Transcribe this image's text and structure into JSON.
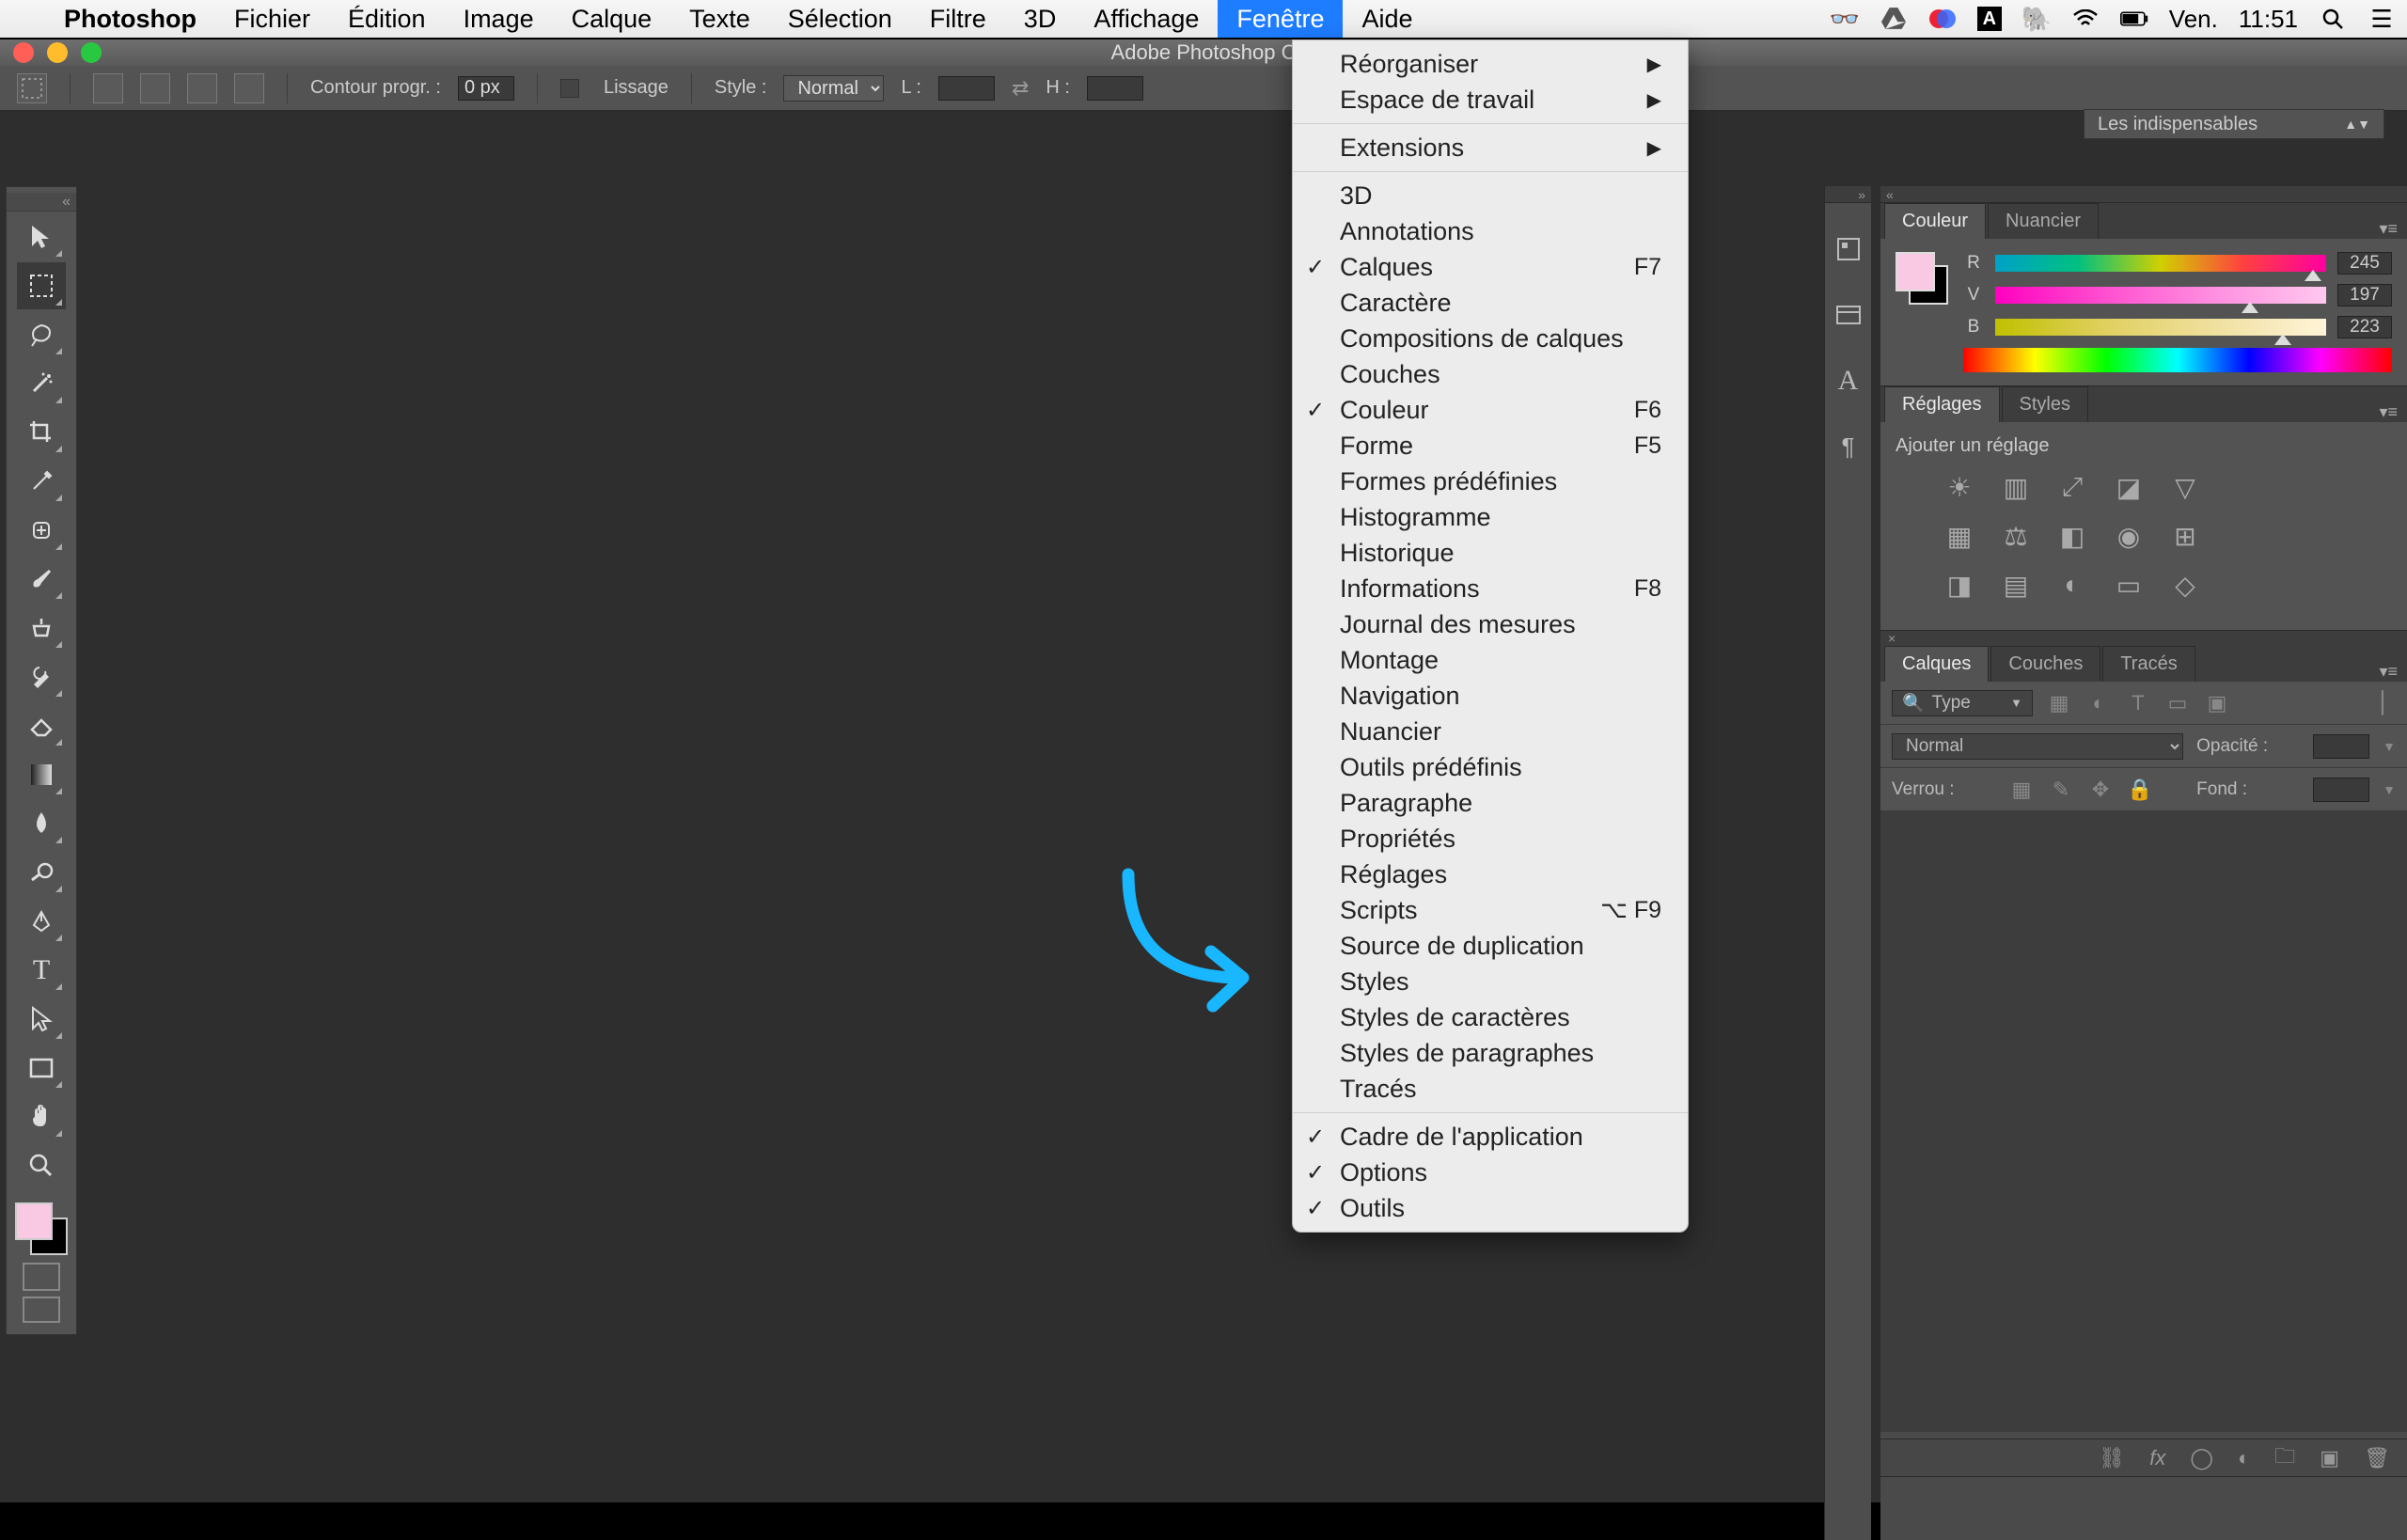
{
  "menubar": {
    "app": "Photoshop",
    "items": [
      "Fichier",
      "Édition",
      "Image",
      "Calque",
      "Texte",
      "Sélection",
      "Filtre",
      "3D",
      "Affichage",
      "Fenêtre",
      "Aide"
    ],
    "activeIndex": 9,
    "right": {
      "day": "Ven.",
      "time": "11:51"
    }
  },
  "window_title": "Adobe Photoshop C",
  "options_bar": {
    "feather_label": "Contour progr. :",
    "feather_value": "0 px",
    "antialias_label": "Lissage",
    "style_label": "Style :",
    "style_value": "Normal",
    "width_label": "L :",
    "height_label": "H :"
  },
  "workspace_selector": "Les indispensables",
  "dropdown": {
    "groups": [
      [
        {
          "label": "Réorganiser",
          "arrow": true
        },
        {
          "label": "Espace de travail",
          "arrow": true
        }
      ],
      [
        {
          "label": "Extensions",
          "arrow": true
        }
      ],
      [
        {
          "label": "3D"
        },
        {
          "label": "Annotations"
        },
        {
          "label": "Calques",
          "checked": true,
          "shortcut": "F7"
        },
        {
          "label": "Caractère"
        },
        {
          "label": "Compositions de calques"
        },
        {
          "label": "Couches"
        },
        {
          "label": "Couleur",
          "checked": true,
          "shortcut": "F6"
        },
        {
          "label": "Forme",
          "shortcut": "F5"
        },
        {
          "label": "Formes prédéfinies"
        },
        {
          "label": "Histogramme"
        },
        {
          "label": "Historique"
        },
        {
          "label": "Informations",
          "shortcut": "F8"
        },
        {
          "label": "Journal des mesures"
        },
        {
          "label": "Montage"
        },
        {
          "label": "Navigation"
        },
        {
          "label": "Nuancier"
        },
        {
          "label": "Outils prédéfinis"
        },
        {
          "label": "Paragraphe"
        },
        {
          "label": "Propriétés"
        },
        {
          "label": "Réglages"
        },
        {
          "label": "Scripts",
          "shortcut": "⌥ F9"
        },
        {
          "label": "Source de duplication"
        },
        {
          "label": "Styles"
        },
        {
          "label": "Styles de caractères"
        },
        {
          "label": "Styles de paragraphes"
        },
        {
          "label": "Tracés"
        }
      ],
      [
        {
          "label": "Cadre de l'application",
          "checked": true
        },
        {
          "label": "Options",
          "checked": true
        },
        {
          "label": "Outils",
          "checked": true
        }
      ]
    ]
  },
  "color_panel": {
    "tab_color": "Couleur",
    "tab_swatches": "Nuancier",
    "channels": [
      {
        "k": "R",
        "v": "245",
        "pos": 96
      },
      {
        "k": "V",
        "v": "197",
        "pos": 77
      },
      {
        "k": "B",
        "v": "223",
        "pos": 87
      }
    ]
  },
  "adjust_panel": {
    "tab_adjust": "Réglages",
    "tab_styles": "Styles",
    "add_label": "Ajouter un réglage"
  },
  "layers_panel": {
    "tab_layers": "Calques",
    "tab_channels": "Couches",
    "tab_paths": "Tracés",
    "filter_type": "Type",
    "blend_mode": "Normal",
    "opacity_label": "Opacité :",
    "lock_label": "Verrou :",
    "fill_label": "Fond :"
  },
  "colors": {
    "fg": "#f9c9e4",
    "bg": "#000000"
  }
}
